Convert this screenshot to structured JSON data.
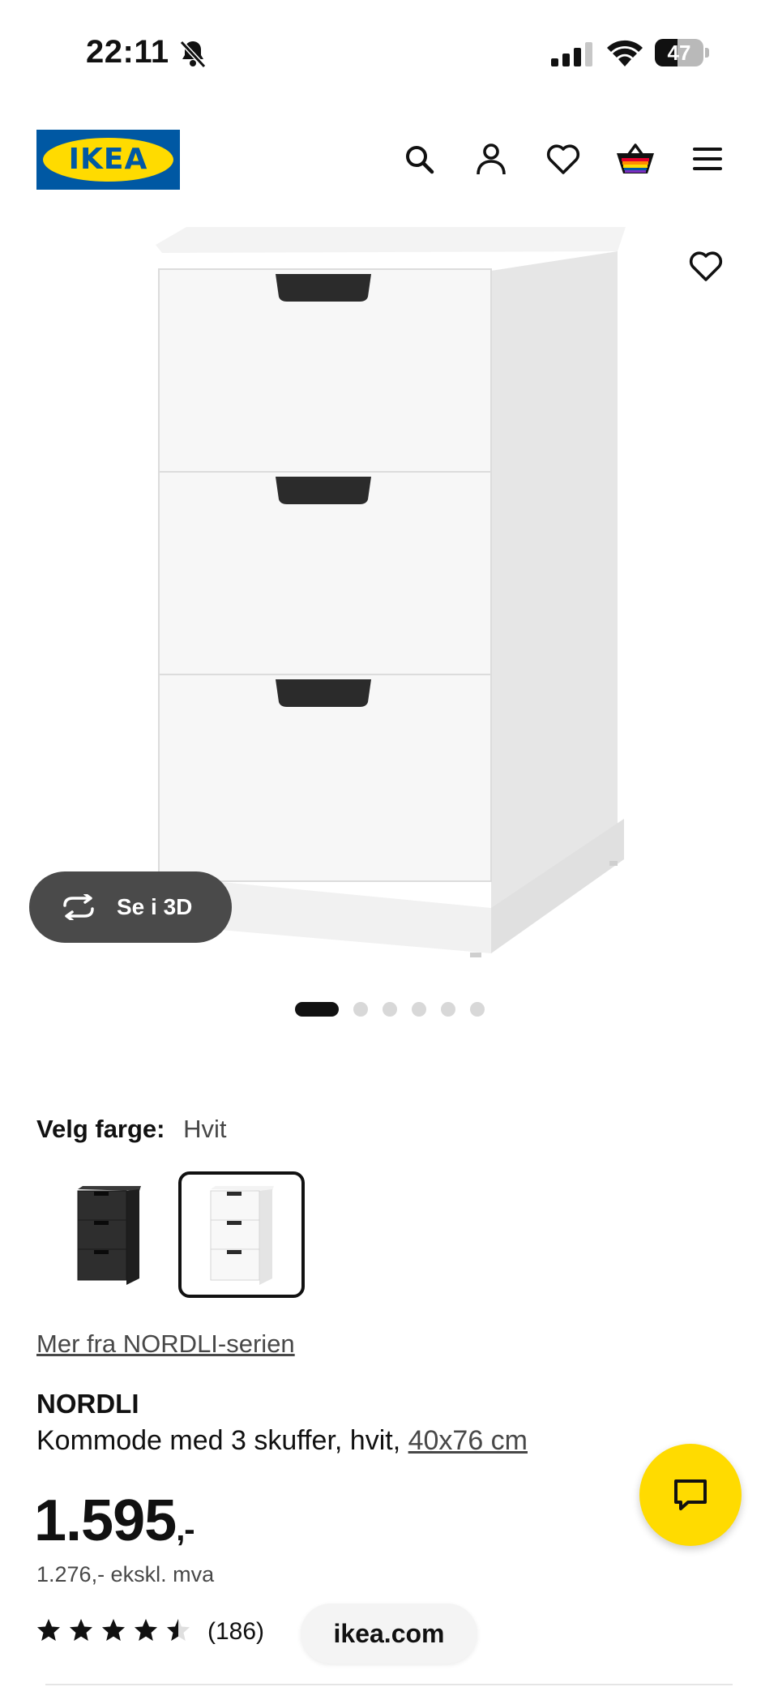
{
  "status_bar": {
    "time": "22:11",
    "battery": "47",
    "battery_level_percent": 47
  },
  "header": {
    "logo_text": "IKEA",
    "icons": [
      "search-icon",
      "account-icon",
      "heart-icon",
      "shopping-bag-icon",
      "menu-icon"
    ]
  },
  "gallery": {
    "view_3d_label": "Se i 3D",
    "image_count": 6,
    "active_index": 0
  },
  "color": {
    "label": "Velg farge:",
    "value": "Hvit",
    "options": [
      "black",
      "white"
    ],
    "selected": "white"
  },
  "product": {
    "series_link": "Mer fra NORDLI-serien",
    "name": "NORDLI",
    "description": "Kommode med 3 skuffer, hvit, ",
    "size": "40x76 cm",
    "price": "1.595",
    "price_suffix": ",-",
    "price_ex_vat": "1.276,- ekskl. mva",
    "rating": 4.5,
    "reviews": "(186)"
  },
  "browser": {
    "url": "ikea.com"
  },
  "colors": {
    "brand_blue": "#0058a3",
    "brand_yellow": "#ffdb00",
    "dark_button": "#4a4a4a"
  }
}
